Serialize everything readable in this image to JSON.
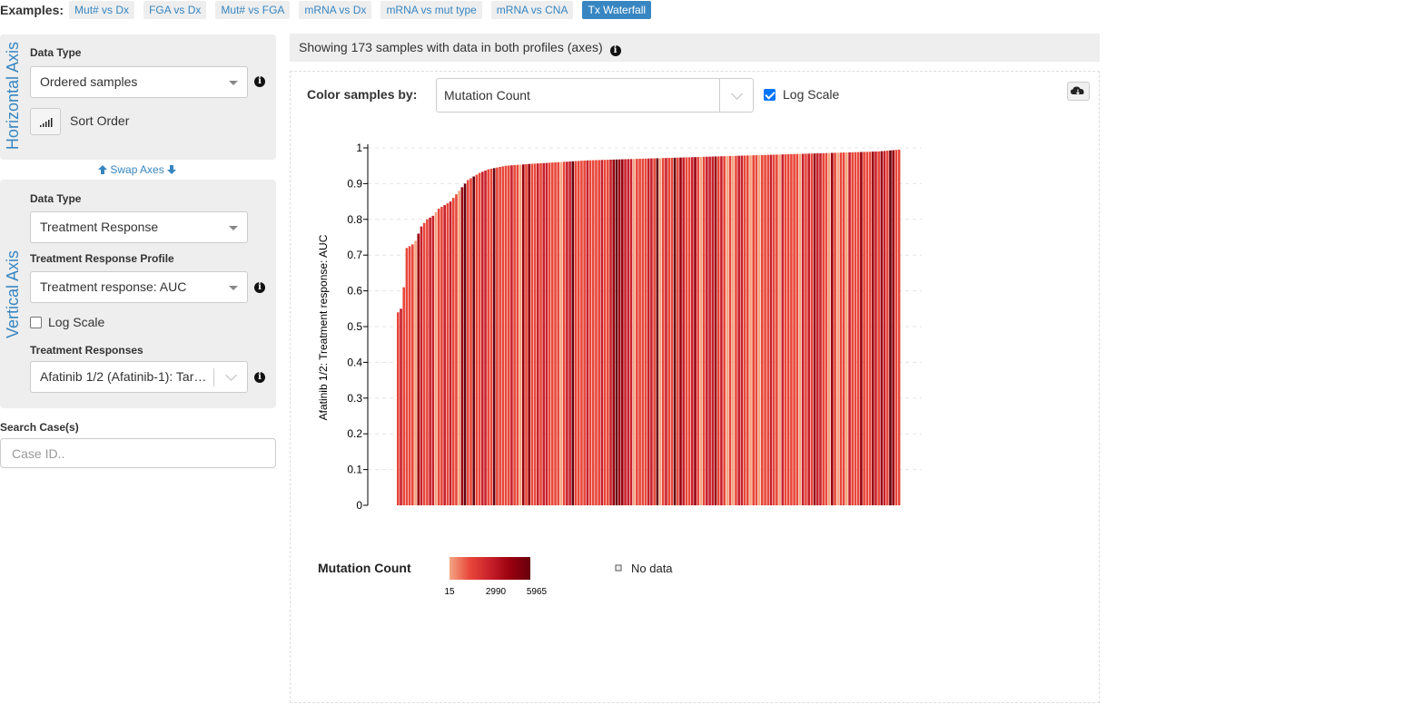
{
  "examples": {
    "label": "Examples:",
    "items": [
      {
        "label": "Mut# vs Dx",
        "active": false
      },
      {
        "label": "FGA vs Dx",
        "active": false
      },
      {
        "label": "Mut# vs FGA",
        "active": false
      },
      {
        "label": "mRNA vs Dx",
        "active": false
      },
      {
        "label": "mRNA vs mut type",
        "active": false
      },
      {
        "label": "mRNA vs CNA",
        "active": false
      },
      {
        "label": "Tx Waterfall",
        "active": true
      }
    ]
  },
  "horizontal": {
    "title": "Horizontal Axis",
    "data_type_label": "Data Type",
    "data_type_value": "Ordered samples",
    "sort_order_label": "Sort Order"
  },
  "swap_label": "Swap Axes",
  "vertical": {
    "title": "Vertical Axis",
    "data_type_label": "Data Type",
    "data_type_value": "Treatment Response",
    "profile_label": "Treatment Response Profile",
    "profile_value": "Treatment response: AUC",
    "log_scale_label": "Log Scale",
    "log_scale_checked": false,
    "responses_label": "Treatment Responses",
    "responses_value": "Afatinib 1/2 (Afatinib-1): Tar…"
  },
  "search": {
    "label": "Search Case(s)",
    "placeholder": "Case ID.."
  },
  "info_bar_text": "Showing 173 samples with data in both profiles (axes)",
  "color_by": {
    "label": "Color samples by:",
    "value": "Mutation Count",
    "log_scale_label": "Log Scale",
    "log_scale_checked": true
  },
  "icons": {
    "info": "info-circle-icon",
    "sort": "bar-chart-ascending-icon",
    "swap_up": "arrow-up-icon",
    "swap_down": "arrow-down-icon",
    "download": "cloud-download-icon"
  },
  "chart_data": {
    "type": "bar",
    "ylabel": "Afatinib 1/2: Treatment response: AUC",
    "ylim": [
      0,
      1
    ],
    "yticks": [
      "0",
      "0.1",
      "0.2",
      "0.3",
      "0.4",
      "0.5",
      "0.6",
      "0.7",
      "0.8",
      "0.9",
      "1"
    ],
    "grid": true,
    "sample_count": 173,
    "sorted_ascending": true,
    "values_anchor": [
      [
        0,
        0.54
      ],
      [
        1,
        0.55
      ],
      [
        2,
        0.61
      ],
      [
        3,
        0.72
      ],
      [
        5,
        0.73
      ],
      [
        6,
        0.74
      ],
      [
        7,
        0.76
      ],
      [
        8,
        0.78
      ],
      [
        10,
        0.8
      ],
      [
        12,
        0.81
      ],
      [
        14,
        0.83
      ],
      [
        16,
        0.84
      ],
      [
        18,
        0.85
      ],
      [
        20,
        0.87
      ],
      [
        22,
        0.89
      ],
      [
        24,
        0.91
      ],
      [
        26,
        0.92
      ],
      [
        28,
        0.93
      ],
      [
        31,
        0.94
      ],
      [
        34,
        0.945
      ],
      [
        37,
        0.95
      ],
      [
        45,
        0.955
      ],
      [
        55,
        0.96
      ],
      [
        65,
        0.965
      ],
      [
        85,
        0.97
      ],
      [
        105,
        0.975
      ],
      [
        125,
        0.98
      ],
      [
        145,
        0.985
      ],
      [
        165,
        0.99
      ],
      [
        172,
        0.995
      ]
    ],
    "color_legend": {
      "title": "Mutation Count",
      "min": "15",
      "mid": "2990",
      "max": "5965",
      "scale_colors": [
        "#f4a582",
        "#e8473a",
        "#c8202b",
        "#99000d",
        "#67000d"
      ],
      "no_data_label": "No data"
    }
  }
}
